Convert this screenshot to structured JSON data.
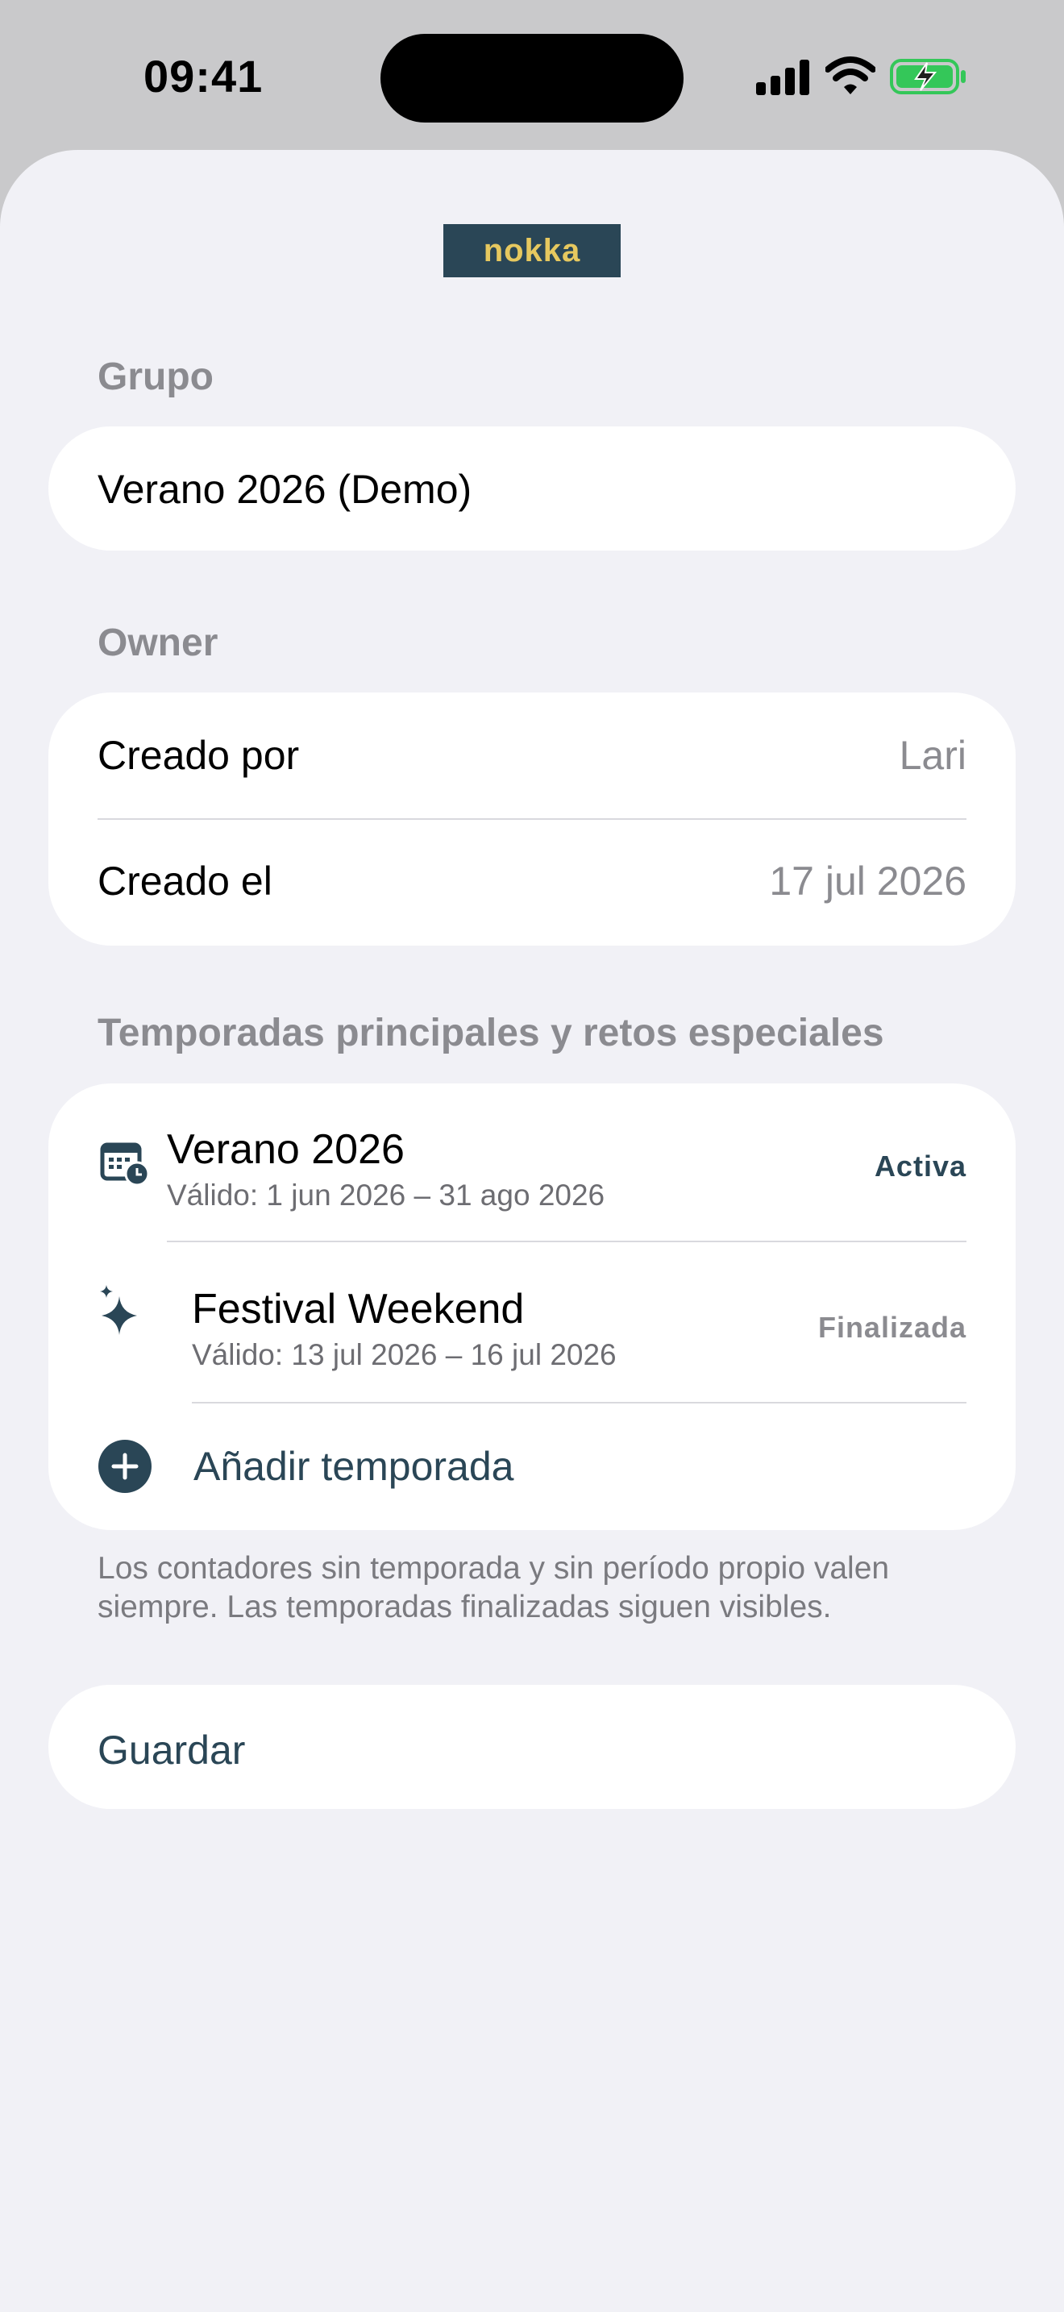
{
  "status_bar": {
    "time": "09:41"
  },
  "brand": {
    "logo_text": "nokka",
    "logo_bg": "#2a4656",
    "logo_fg": "#e6c85f",
    "accent": "#2a4656"
  },
  "group": {
    "section_label": "Grupo",
    "name_value": "Verano 2026 (Demo)"
  },
  "owner": {
    "section_label": "Owner",
    "created_by_label": "Creado por",
    "created_by_value": "Lari",
    "created_on_label": "Creado el",
    "created_on_value": "17 jul 2026"
  },
  "seasons": {
    "section_label": "Temporadas principales y retos especiales",
    "items": [
      {
        "title": "Verano 2026",
        "subtitle": "Válido: 1 jun 2026 – 31 ago 2026",
        "status": "Activa",
        "icon": "calendar-clock-icon"
      },
      {
        "title": "Festival Weekend",
        "subtitle": "Válido: 13 jul 2026 – 16 jul 2026",
        "status": "Finalizada",
        "icon": "sparkles-icon"
      }
    ],
    "add_label": "Añadir temporada",
    "footnote": "Los contadores sin temporada y sin período propio valen siempre. Las temporadas finalizadas siguen visibles."
  },
  "actions": {
    "save_label": "Guardar"
  }
}
